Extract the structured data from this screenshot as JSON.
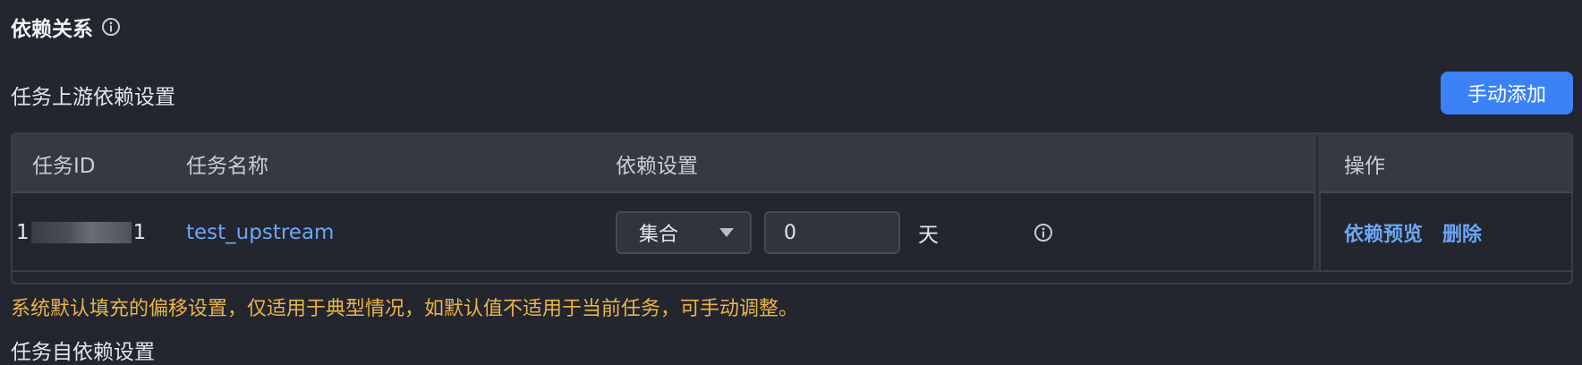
{
  "section": {
    "title": "依赖关系",
    "info_icon": "info-circle-icon"
  },
  "upstream": {
    "title": "任务上游依赖设置",
    "add_button": "手动添加",
    "columns": [
      "任务ID",
      "任务名称",
      "依赖设置",
      "操作"
    ],
    "rows": [
      {
        "task_id_prefix": "1",
        "task_id_suffix": "1",
        "task_name": "test_upstream",
        "dependency_type": "集合",
        "offset_value": "0",
        "unit": "天",
        "actions": [
          "依赖预览",
          "删除"
        ]
      }
    ]
  },
  "hint": "系统默认填充的偏移设置，仅适用于典型情况，如默认值不适用于当前任务，可手动调整。",
  "self_dependency": {
    "title": "任务自依赖设置"
  },
  "colors": {
    "background": "#23262e",
    "primary": "#3b82f6",
    "link": "#6aa7f5",
    "warning": "#e8b44a"
  }
}
